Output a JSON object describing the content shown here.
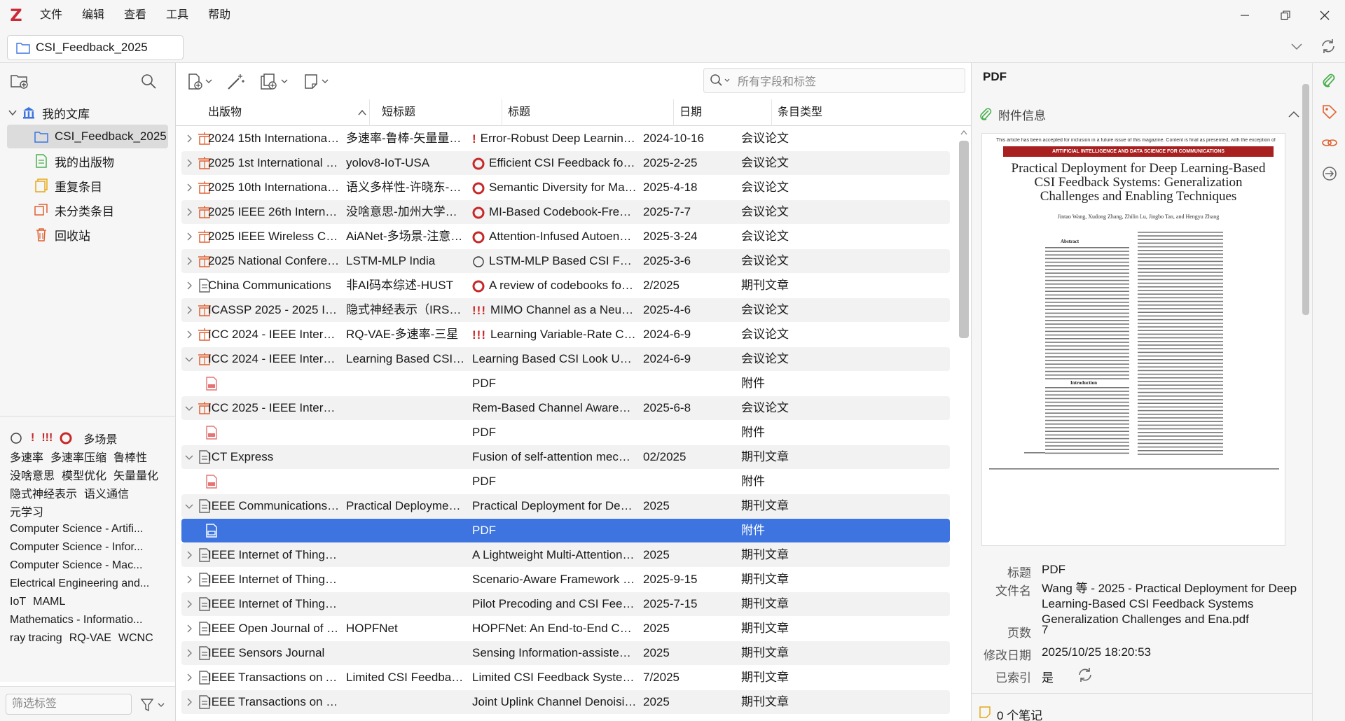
{
  "menu": {
    "file": "文件",
    "edit": "编辑",
    "view": "查看",
    "tools": "工具",
    "help": "帮助"
  },
  "tab": {
    "title": "CSI_Feedback_2025"
  },
  "search": {
    "placeholder": "所有字段和标签"
  },
  "library": {
    "root": "我的文库",
    "items": [
      "CSI_Feedback_2025",
      "我的出版物",
      "重复条目",
      "未分类条目",
      "回收站"
    ]
  },
  "tags": {
    "row1": [
      "多场景"
    ],
    "row2": [
      "多速率",
      "多速率压缩",
      "鲁棒性"
    ],
    "row3": [
      "没啥意思",
      "模型优化",
      "矢量量化"
    ],
    "row4": [
      "隐式神经表示",
      "语义通信"
    ],
    "row5": [
      "元学习"
    ],
    "list": [
      "Computer Science - Artifi...",
      "Computer Science - Infor...",
      "Computer Science - Mac...",
      "Electrical Engineering and...",
      "IoT",
      "MAML",
      "Mathematics - Informatio...",
      "ray tracing",
      "RQ-VAE",
      "WCNC"
    ],
    "filter_placeholder": "筛选标签"
  },
  "columns": {
    "publication": "出版物",
    "short_title": "短标题",
    "title": "标题",
    "date": "日期",
    "type": "条目类型"
  },
  "rows": [
    {
      "pub": "2024 15th International Co...",
      "short": "多速率-鲁棒-矢量量化-K...",
      "badge": "bang1",
      "title": "Error-Robust Deep Learning-Bas...",
      "date": "2024-10-16",
      "type": "会议论文"
    },
    {
      "pub": "2025 1st International Con...",
      "short": "yolov8-IoT-USA",
      "badge": "ring",
      "title": "Efficient CSI Feedback for Larg...",
      "date": "2025-2-25",
      "type": "会议论文"
    },
    {
      "pub": "2025 10th International Co...",
      "short": "语义多样性-许晓东-BUPT",
      "badge": "ring",
      "title": "Semantic Diversity for Massive...",
      "date": "2025-4-18",
      "type": "会议论文"
    },
    {
      "pub": "2025 IEEE 26th Internation...",
      "short": "没啥意思-加州大学、伦敦...",
      "badge": "ring",
      "title": "MI-Based Codebook-Free CSI ...",
      "date": "2025-7-7",
      "type": "会议论文"
    },
    {
      "pub": "2025 IEEE Wireless Comm...",
      "short": "AiANet-多场景-注意力机...",
      "badge": "ring",
      "title": "Attention-Infused Autoencode...",
      "date": "2025-3-24",
      "type": "会议论文"
    },
    {
      "pub": "2025 National Conference ...",
      "short": "LSTM-MLP India",
      "badge": "circle",
      "title": "LSTM-MLP Based CSI Feedbac...",
      "date": "2025-3-6",
      "type": "会议论文"
    },
    {
      "pub": "China Communications",
      "short": "非AI码本综述-HUST",
      "badge": "ring",
      "title": "A review of codebooks for CSI...",
      "date": "2/2025",
      "type": "期刊文章"
    },
    {
      "pub": "ICASSP 2025 - 2025 IEEE I...",
      "short": "隐式神经表示（IRS）-元...",
      "badge": "bang3",
      "title": "MIMO Channel as a Neural F...",
      "date": "2025-4-6",
      "type": "会议论文"
    },
    {
      "pub": "ICC 2024 - IEEE Internation...",
      "short": "RQ-VAE-多速率-三星",
      "badge": "bang3",
      "title": "Learning Variable-Rate CSI Co...",
      "date": "2024-6-9",
      "type": "会议论文"
    },
    {
      "pub": "ICC 2024 - IEEE Internation...",
      "short": "Learning Based CSI Loo...",
      "badge": "",
      "title": "Learning Based CSI Look Up Table...",
      "date": "2024-6-9",
      "type": "会议论文"
    },
    {
      "pub": "",
      "short": "",
      "badge": "",
      "title": "PDF",
      "date": "",
      "type": "附件"
    },
    {
      "pub": "ICC 2025 - IEEE Internation...",
      "short": "",
      "badge": "",
      "title": "Rem-Based Channel Awareness in...",
      "date": "2025-6-8",
      "type": "会议论文"
    },
    {
      "pub": "",
      "short": "",
      "badge": "",
      "title": "PDF",
      "date": "",
      "type": "附件"
    },
    {
      "pub": "ICT Express",
      "short": "",
      "badge": "",
      "title": "Fusion of self-attention mechanis...",
      "date": "02/2025",
      "type": "期刊文章"
    },
    {
      "pub": "",
      "short": "",
      "badge": "",
      "title": "PDF",
      "date": "",
      "type": "附件"
    },
    {
      "pub": "IEEE Communications Mag...",
      "short": "Practical Deployment fo...",
      "badge": "",
      "title": "Practical Deployment for Deep Le...",
      "date": "2025",
      "type": "期刊文章"
    },
    {
      "pub": "",
      "short": "",
      "badge": "",
      "title": "PDF",
      "date": "",
      "type": "附件"
    },
    {
      "pub": "IEEE Internet of Things Jou...",
      "short": "",
      "badge": "",
      "title": "A Lightweight Multi-Attention Ne...",
      "date": "2025",
      "type": "期刊文章"
    },
    {
      "pub": "IEEE Internet of Things Jou...",
      "short": "",
      "badge": "",
      "title": "Scenario-Aware Framework for D...",
      "date": "2025-9-15",
      "type": "期刊文章"
    },
    {
      "pub": "IEEE Internet of Things Jou...",
      "short": "",
      "badge": "",
      "title": "Pilot Precoding and CSI Feedback...",
      "date": "2025-7-15",
      "type": "期刊文章"
    },
    {
      "pub": "IEEE Open Journal of Vehic...",
      "short": "HOPFNet",
      "badge": "",
      "title": "HOPFNet: An End-to-End CSI Acq...",
      "date": "2025",
      "type": "期刊文章"
    },
    {
      "pub": "IEEE Sensors Journal",
      "short": "",
      "badge": "",
      "title": "Sensing Information-assisted CSI ...",
      "date": "2025",
      "type": "期刊文章"
    },
    {
      "pub": "IEEE Transactions on Ante...",
      "short": "Limited CSI Feedback S...",
      "badge": "",
      "title": "Limited CSI Feedback System for ...",
      "date": "7/2025",
      "type": "期刊文章"
    },
    {
      "pub": "IEEE Transactions on Com...",
      "short": "",
      "badge": "",
      "title": "Joint Uplink Channel Denoising a...",
      "date": "2025",
      "type": "期刊文章"
    }
  ],
  "pane": {
    "header": "PDF",
    "section": "附件信息",
    "paper_notice": "This article has been accepted for inclusion in a future issue of this magazine. Content is final as presented, with the exception of pagination.",
    "paper_banner": "ARTIFICIAL INTELLIGENCE AND DATA SCIENCE FOR COMMUNICATIONS",
    "paper_title": "Practical Deployment for Deep Learning-Based CSI Feedback Systems: Generalization Challenges and Enabling Techniques",
    "paper_authors": "Jintao Wang, Xudong Zhang, Zhilin Lu, Jingbo Tan, and Hengyu Zhang",
    "paper_abstract": "Abstract",
    "paper_intro": "Introduction",
    "meta_title_label": "标题",
    "meta_title": "PDF",
    "meta_file_label": "文件名",
    "meta_file": "Wang 等 - 2025 - Practical Deployment for Deep Learning-Based CSI Feedback Systems Generalization Challenges and Ena.pdf",
    "meta_pages_label": "页数",
    "meta_pages": "7",
    "meta_modified_label": "修改日期",
    "meta_modified": "2025/10/25 18:20:53",
    "meta_indexed_label": "已索引",
    "meta_indexed": "是",
    "notes": "0 个笔记"
  },
  "colors": {
    "accent": "#3d74e0",
    "tag_red": "#c62828",
    "zotero_red": "#cc2936"
  }
}
